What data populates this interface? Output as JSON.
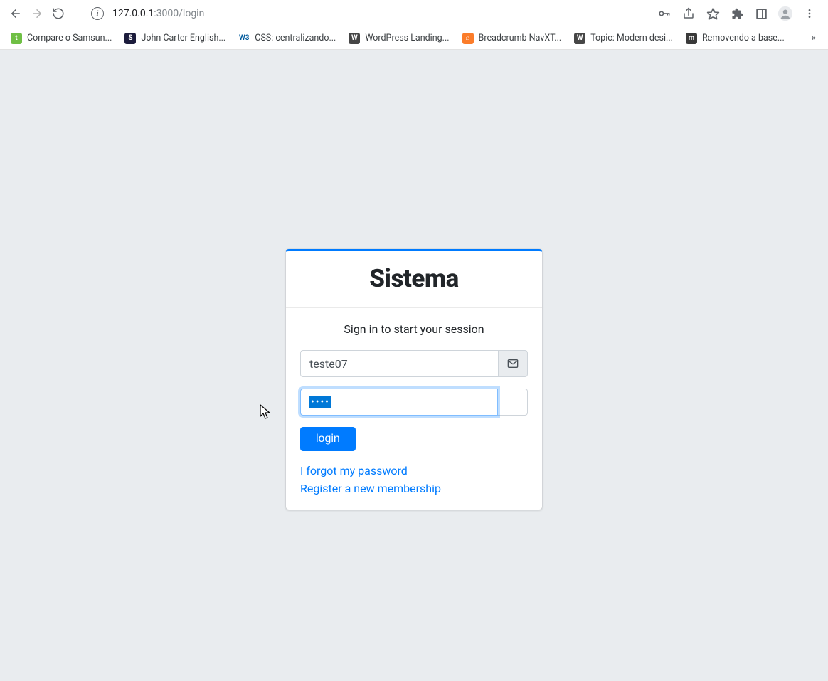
{
  "browser": {
    "url_host": "127.0.0.1",
    "url_port_path": ":3000/login"
  },
  "bookmarks": [
    {
      "label": "Compare o Samsun...",
      "iconBg": "#6fbf44",
      "iconText": "t"
    },
    {
      "label": "John Carter English...",
      "iconBg": "#1c1c3c",
      "iconText": "S"
    },
    {
      "label": "CSS: centralizando...",
      "iconBg": "#ffffff",
      "iconText": "W3",
      "iconColor": "#005a9c"
    },
    {
      "label": "WordPress Landing...",
      "iconBg": "#464646",
      "iconText": "W"
    },
    {
      "label": "Breadcrumb NavXT...",
      "iconBg": "#fb7c2a",
      "iconText": "⌂"
    },
    {
      "label": "Topic: Modern desi...",
      "iconBg": "#464646",
      "iconText": "W"
    },
    {
      "label": "Removendo a base...",
      "iconBg": "#3a3a3a",
      "iconText": "m"
    }
  ],
  "login": {
    "brand": "Sistema",
    "subtitle": "Sign in to start your session",
    "username_value": "teste07",
    "password_dots": "••••",
    "login_button": "login",
    "forgot_link": "I forgot my password",
    "register_link": "Register a new membership"
  }
}
